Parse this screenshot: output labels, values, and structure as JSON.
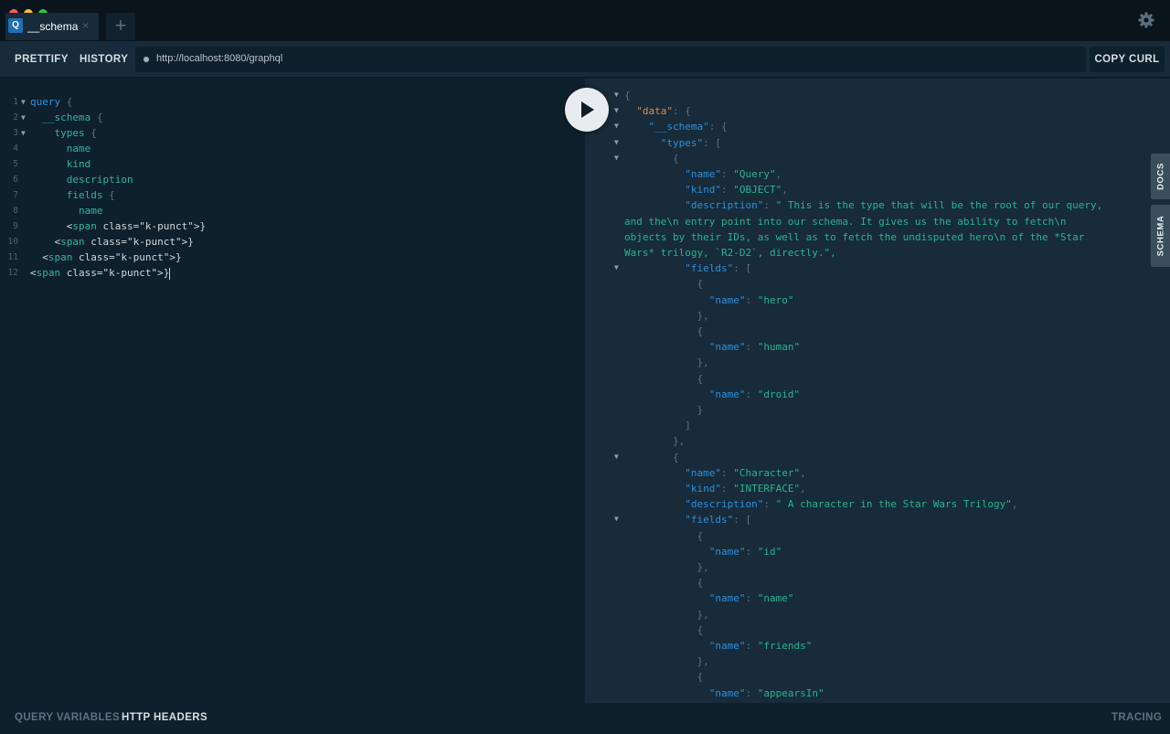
{
  "window": {
    "tab": {
      "badge": "Q",
      "title": "__schema",
      "close": "×"
    },
    "new_tab": "+"
  },
  "toolbar": {
    "prettify": "PRETTIFY",
    "history": "HISTORY",
    "endpoint": "http://localhost:8080/graphql",
    "copy_curl": "COPY CURL"
  },
  "query_editor": {
    "lines": [
      {
        "n": "1",
        "text": "query {",
        "fold": true
      },
      {
        "n": "2",
        "text": "  __schema {",
        "fold": true
      },
      {
        "n": "3",
        "text": "    types {",
        "fold": true
      },
      {
        "n": "4",
        "text": "      name"
      },
      {
        "n": "5",
        "text": "      kind"
      },
      {
        "n": "6",
        "text": "      description"
      },
      {
        "n": "7",
        "text": "      fields {"
      },
      {
        "n": "8",
        "text": "        name"
      },
      {
        "n": "9",
        "text": "      }"
      },
      {
        "n": "10",
        "text": "    }"
      },
      {
        "n": "11",
        "text": "  }"
      },
      {
        "n": "12",
        "text": "}"
      }
    ]
  },
  "result": {
    "lines": [
      {
        "text": "{",
        "fold": true
      },
      {
        "text": "  \"data\": {",
        "fold": true
      },
      {
        "text": "    \"__schema\": {",
        "fold": true
      },
      {
        "text": "      \"types\": [",
        "fold": true
      },
      {
        "text": "        {",
        "fold": true
      },
      {
        "text": "          \"name\": \"Query\","
      },
      {
        "text": "          \"kind\": \"OBJECT\","
      },
      {
        "text": "          \"description\": \" This is the type that will be the root of our query,"
      },
      {
        "text": "and the\\n entry point into our schema. It gives us the ability to fetch\\n"
      },
      {
        "text": "objects by their IDs, as well as to fetch the undisputed hero\\n of the *Star"
      },
      {
        "text": "Wars* trilogy, `R2-D2`, directly.\","
      },
      {
        "text": "          \"fields\": [",
        "fold": true
      },
      {
        "text": "            {"
      },
      {
        "text": "              \"name\": \"hero\""
      },
      {
        "text": "            },"
      },
      {
        "text": "            {"
      },
      {
        "text": "              \"name\": \"human\""
      },
      {
        "text": "            },"
      },
      {
        "text": "            {"
      },
      {
        "text": "              \"name\": \"droid\""
      },
      {
        "text": "            }"
      },
      {
        "text": "          ]"
      },
      {
        "text": "        },"
      },
      {
        "text": "        {",
        "fold": true
      },
      {
        "text": "          \"name\": \"Character\","
      },
      {
        "text": "          \"kind\": \"INTERFACE\","
      },
      {
        "text": "          \"description\": \" A character in the Star Wars Trilogy\","
      },
      {
        "text": "          \"fields\": [",
        "fold": true
      },
      {
        "text": "            {"
      },
      {
        "text": "              \"name\": \"id\""
      },
      {
        "text": "            },"
      },
      {
        "text": "            {"
      },
      {
        "text": "              \"name\": \"name\""
      },
      {
        "text": "            },"
      },
      {
        "text": "            {"
      },
      {
        "text": "              \"name\": \"friends\""
      },
      {
        "text": "            },"
      },
      {
        "text": "            {"
      },
      {
        "text": "              \"name\": \"appearsIn\""
      }
    ]
  },
  "side_tabs": {
    "docs": "DOCS",
    "schema": "SCHEMA"
  },
  "bottom_bar": {
    "query_variables": "QUERY VARIABLES",
    "http_headers": "HTTP HEADERS",
    "tracing": "TRACING"
  },
  "icons": {
    "settings": "gear-icon",
    "run": "play-icon"
  }
}
